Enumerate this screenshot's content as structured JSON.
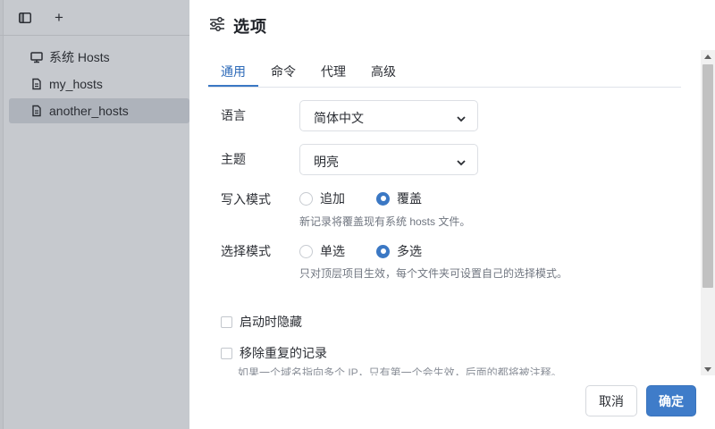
{
  "app": {
    "toolbar": {
      "sidebar_icon": "sidebar-toggle-icon",
      "add_icon": "plus-icon",
      "add_glyph": "+"
    },
    "list": [
      {
        "icon": "monitor-icon",
        "label": "系统 Hosts",
        "selected": false
      },
      {
        "icon": "file-icon",
        "label": "my_hosts",
        "selected": false
      },
      {
        "icon": "file-icon",
        "label": "another_hosts",
        "selected": true
      }
    ]
  },
  "dialog": {
    "title_icon": "sliders-icon",
    "title": "选项",
    "tabs": [
      {
        "label": "通用",
        "active": true
      },
      {
        "label": "命令",
        "active": false
      },
      {
        "label": "代理",
        "active": false
      },
      {
        "label": "高级",
        "active": false
      }
    ],
    "language": {
      "label": "语言",
      "value": "简体中文"
    },
    "theme": {
      "label": "主题",
      "value": "明亮"
    },
    "write_mode": {
      "label": "写入模式",
      "options": [
        {
          "label": "追加",
          "checked": false
        },
        {
          "label": "覆盖",
          "checked": true
        }
      ],
      "hint": "新记录将覆盖现有系统 hosts 文件。"
    },
    "choice_mode": {
      "label": "选择模式",
      "options": [
        {
          "label": "单选",
          "checked": false
        },
        {
          "label": "多选",
          "checked": true
        }
      ],
      "hint": "只对顶层项目生效，每个文件夹可设置自己的选择模式。"
    },
    "checkboxes": [
      {
        "label": "启动时隐藏",
        "checked": false
      },
      {
        "label": "移除重复的记录",
        "checked": false
      }
    ],
    "cut_hint": "如果一个域名指向多个 IP，只有第一个会生效，后面的都将被注释。",
    "buttons": {
      "cancel": "取消",
      "ok": "确定"
    },
    "colors": {
      "accent": "#3b78c4",
      "primary_button": "#3f7cc9",
      "overlay": "#c6c9ce"
    }
  }
}
